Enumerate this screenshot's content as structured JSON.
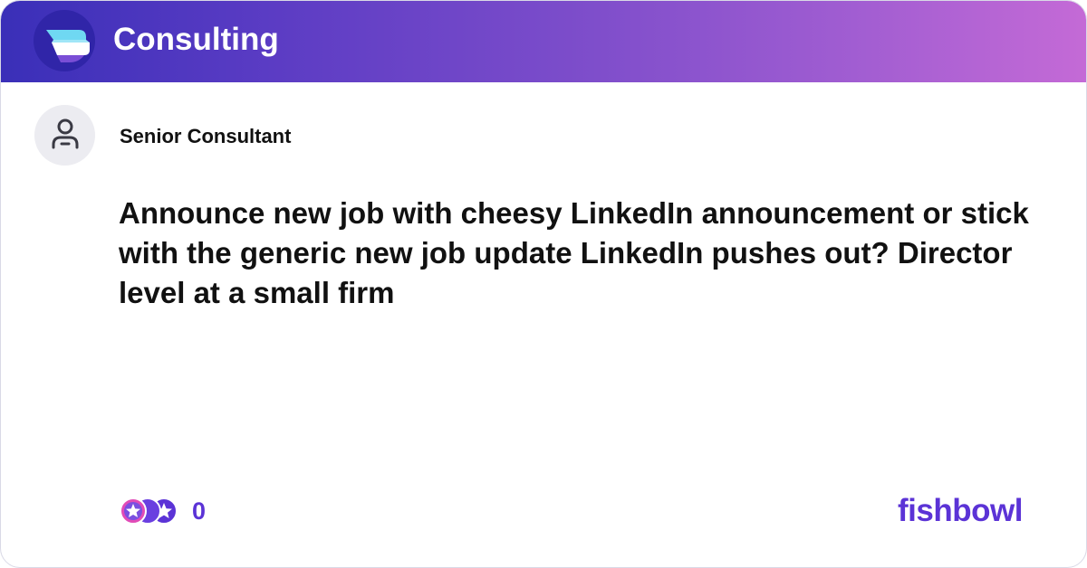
{
  "header": {
    "title": "Consulting",
    "logo_icon": "fishbowl-bowl-icon"
  },
  "post": {
    "author": "Senior Consultant",
    "avatar_icon": "anonymous-user-icon",
    "body": "Announce new job with cheesy LinkedIn announcement or stick with the generic new job update LinkedIn pushes out? Director level at a small firm"
  },
  "footer": {
    "reaction_icons": [
      "star-reaction-icon",
      "moon-reaction-icon",
      "star-reaction-icon"
    ],
    "reaction_count": "0",
    "brand": "fishbowl"
  },
  "colors": {
    "header_gradient_start": "#3a2fb8",
    "header_gradient_end": "#c46ad6",
    "accent": "#5b33d6",
    "text": "#111111"
  }
}
